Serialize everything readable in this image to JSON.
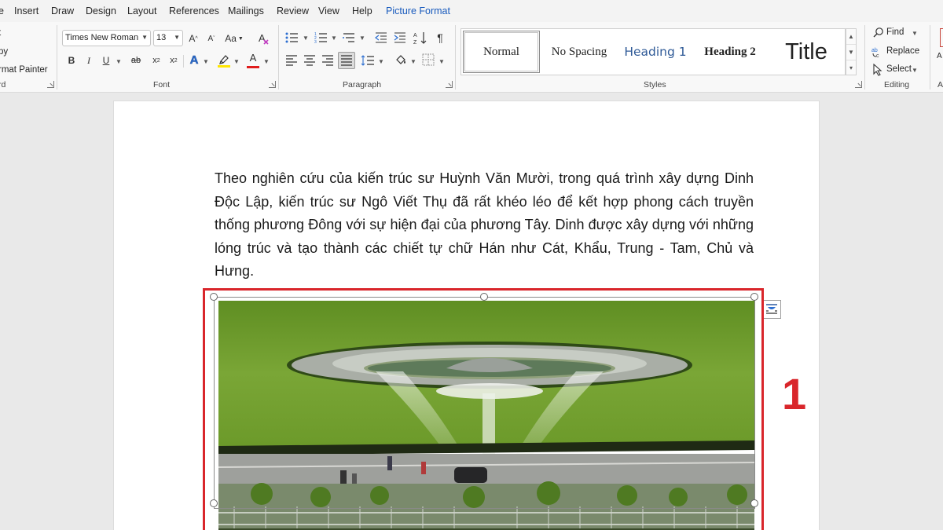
{
  "tabs": {
    "partial": "e",
    "items": [
      "Insert",
      "Draw",
      "Design",
      "Layout",
      "References",
      "Mailings",
      "Review",
      "View",
      "Help"
    ],
    "active": "Picture Format"
  },
  "clipboard": {
    "cut_label": "t",
    "copy_label": "py",
    "format_painter_label": "rmat Painter",
    "group_label": "rd"
  },
  "font": {
    "family": "Times New Roman",
    "size": "13",
    "case_label": "Aa",
    "bold": "B",
    "italic": "I",
    "underline": "U",
    "strike": "ab",
    "subscript": "x",
    "sub_mark": "2",
    "superscript": "x",
    "sup_mark": "2",
    "effects": "A",
    "color": "A",
    "group_label": "Font"
  },
  "paragraph": {
    "group_label": "Paragraph",
    "pilcrow": "¶"
  },
  "styles": {
    "items": [
      "Normal",
      "No Spacing",
      "Heading 1",
      "Heading 2",
      "Title"
    ],
    "selected": "Normal",
    "group_label": "Styles"
  },
  "editing": {
    "find": "Find",
    "replace": "Replace",
    "select": "Select",
    "group_label": "Editing",
    "cut_off_label": "A"
  },
  "document": {
    "paragraph": "Theo nghiên cứu của kiến trúc sư Huỳnh Văn Mười, trong quá trình xây dựng Dinh Độc Lập, kiến trúc sư Ngô Viết Thụ đã rất khéo léo để kết hợp phong cách truyền thống phương Đông với sự hiện đại của phương Tây. Dinh được xây dựng với những lóng trúc và tạo thành các chiết tự chữ Hán như Cát, Khẩu, Trung - Tam, Chủ và Hưng.",
    "marker": "1"
  },
  "colors": {
    "accent": "#185abd",
    "highlight": "#d9262b",
    "grass": "#6e9a2a"
  }
}
